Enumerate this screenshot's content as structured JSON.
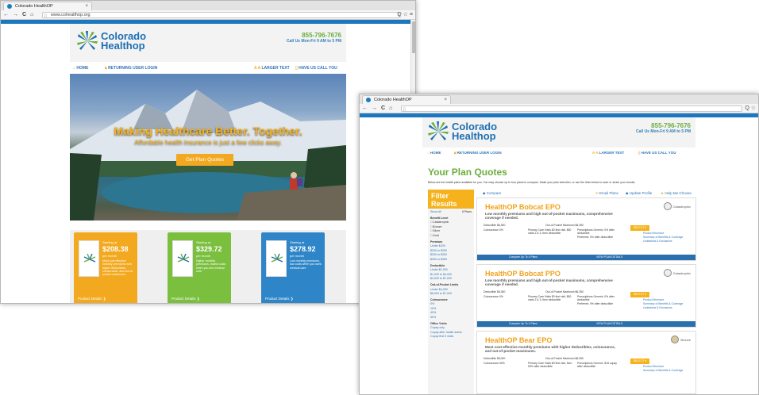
{
  "browser1": {
    "tab_title": "Colorado HealthOP",
    "tab_close": "×",
    "back": "←",
    "forward": "→",
    "reload": "C",
    "home": "⌂",
    "url": "www.coheatlhop.org",
    "right_icons": "Q ☆ ≡"
  },
  "browser2": {
    "tab_title": "Colorado HealthOP",
    "tab_close": "×",
    "back": "←",
    "forward": "→",
    "reload": "C",
    "home": "⌂",
    "right_icons": "Q ☆"
  },
  "site": {
    "logo_line1": "Colorado",
    "logo_line2": "Healthop",
    "phone": "855-796-7676",
    "hours": "Call Us Mon-Fri 9 AM to 5 PM",
    "nav_home": "HOME",
    "nav_login": "RETURNING USER LOGIN",
    "nav_larger": "LARGER TEXT",
    "nav_call": "HAVE US CALL YOU",
    "nav_larger_icon": "A A"
  },
  "home": {
    "headline": "Making Healthcare Better. Together.",
    "subheadline": "Affordable health insurance is just a few clicks away.",
    "cta": "Get Plan Quotes",
    "cards": [
      {
        "starting": "Starting at",
        "price": "$208.38",
        "per": "per month",
        "desc": "Most cost effective monthly premiums with higher deductibles, coinsurance, and out-of-pocket maximums.",
        "details": "Product Details ❯"
      },
      {
        "starting": "Starting at",
        "price": "$329.72",
        "per": "per month",
        "desc": "Higher monthly premiums, lowest costs when you see medical care.",
        "details": "Product Details ❯"
      },
      {
        "starting": "Starting at",
        "price": "$278.92",
        "per": "per month",
        "desc": "Low monthly premiums, low costs when you seek medical care.",
        "details": "Product Details ❯"
      }
    ],
    "colors": {
      "orange": "#f3a91f",
      "green": "#7bbf3f",
      "blue": "#2e85c8"
    }
  },
  "quotes": {
    "title": "Your Plan Quotes",
    "description": "Below are the health plans available for you. You may choose up to four plans to compare. Make your plan selection, or use the links below to save or share your results.",
    "filter_title": "Filter Results",
    "filter_show_all": "Show All",
    "filter_plans": "8 Plans",
    "filter_groups": [
      {
        "label": "Benefit Level",
        "options": [
          "Catastrophic",
          "Bronze",
          "Silver",
          "Gold"
        ]
      },
      {
        "label": "Premium",
        "options": [
          "Under $200",
          "$200 to $250",
          "$250 to $300",
          "$300 to $350"
        ]
      },
      {
        "label": "Deductible",
        "options": [
          "Under $1,000",
          "$1,000 to $4,000",
          "$4,000 to $7,000"
        ]
      },
      {
        "label": "Out-of-Pocket Limits",
        "options": [
          "Under $4,000",
          "$6,000 to $7,000"
        ]
      },
      {
        "label": "Coinsurance",
        "options": [
          "0%",
          "10%",
          "40%",
          "50%"
        ]
      },
      {
        "label": "Office Visits",
        "options": [
          "Copay only",
          "Copay after health action",
          "Copay first 3 visits"
        ]
      }
    ],
    "compare": "Compare",
    "email_plans": "Email Plans",
    "update_profile": "Update Profile",
    "help": "Help Me Choose",
    "plans": [
      {
        "name": "HealthOP Bobcat EPO",
        "desc": "Low monthly premiums and high out-of-pocket maximums, comprehensive coverage if needed.",
        "tier": "Catastrophic",
        "deductible": "Deductible $6,350",
        "oop": "Out-of-Pocket Maximum $6,350",
        "coins": "Coinsurance 0%",
        "pcv": "Primary Care Visits $0 first visit, $50 visits 2 & 3, then deductible",
        "rx": "Prescriptions Generic: 0% after deductible",
        "rx2": "Preferred: 0% after deductible",
        "select": "SELECT ▾",
        "link1": "Product Brochure",
        "link2": "Summary of Benefits & Coverage",
        "link3": "Limitations & Exclusions",
        "compare_up": "Compare Up To 4 Plans",
        "view_details": "VIEW PLAN DETAILS"
      },
      {
        "name": "HealthOP Bobcat PPO",
        "desc": "Low monthly premiums and high out-of-pocket maximums, comprehensive coverage if needed.",
        "tier": "Catastrophic",
        "deductible": "Deductible $6,350",
        "oop": "Out-of-Pocket Maximum $6,350",
        "coins": "Coinsurance 0%",
        "pcv": "Primary Care Visits $0 first visit, $50 visits 2 & 3, then deductible",
        "rx": "Prescriptions Generic: 0% after deductible",
        "rx2": "Preferred: 0% after deductible",
        "select": "SELECT ▾",
        "link1": "Product Brochure",
        "link2": "Summary of Benefits & Coverage",
        "link3": "Limitations & Exclusions",
        "compare_up": "Compare Up To 4 Plans",
        "view_details": "VIEW PLAN DETAILS"
      },
      {
        "name": "HealthOP Bear EPO",
        "desc": "Most cost-effective monthly premiums with higher deductibles, coinsurance, and out-of-pocket maximums.",
        "tier": "Bronze",
        "deductible": "Deductible $5,000",
        "oop": "Out-of-Pocket Maximum $6,350",
        "coins": "Coinsurance 50%",
        "pcv": "Primary Care Visits $0 first visit, then 50% after deductible",
        "rx": "Prescriptions Generic: $15 copay after deductible",
        "rx2": "",
        "select": "SELECT ▾",
        "link1": "Product Brochure",
        "link2": "Summary of Benefits & Coverage",
        "link3": "",
        "compare_up": "",
        "view_details": ""
      }
    ]
  }
}
